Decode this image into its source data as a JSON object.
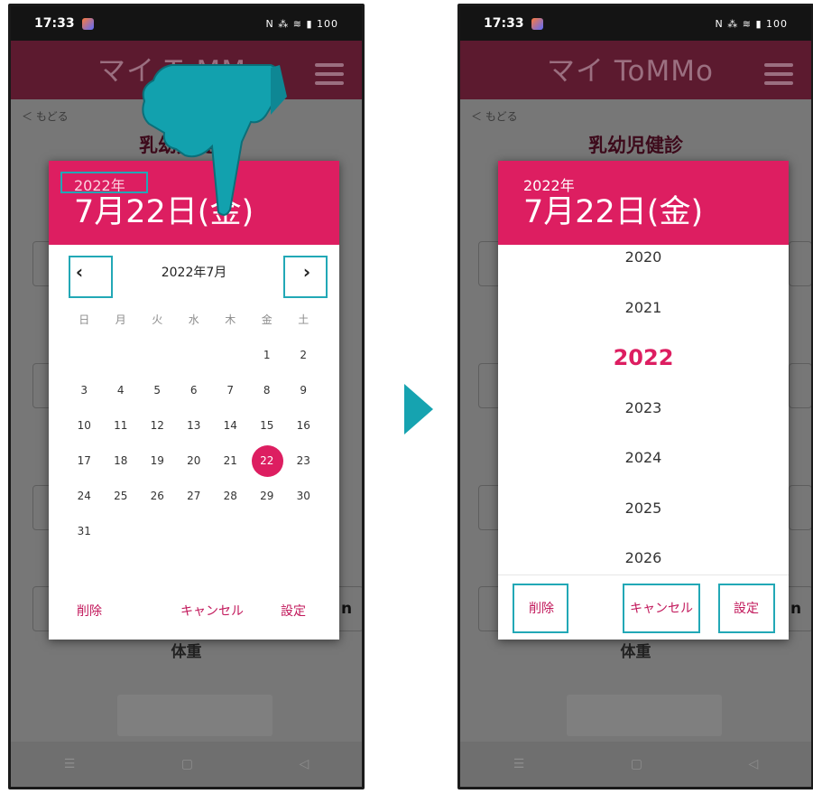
{
  "status": {
    "time": "17:33",
    "system": "N ⁂ ≋ ▮ 100"
  },
  "app": {
    "logo": "マイ ToMMo"
  },
  "header": {
    "back": "＜ もどる",
    "title": "乳幼児健診"
  },
  "form": {
    "weight_label": "体重",
    "unit_visible": "n"
  },
  "datepicker": {
    "year": "2022年",
    "date": "7月22日(金)",
    "month_label": "2022年7月",
    "weekdays": [
      "日",
      "月",
      "火",
      "水",
      "木",
      "金",
      "土"
    ],
    "weeks": [
      [
        "",
        "",
        "",
        "",
        "",
        "1",
        "2"
      ],
      [
        "3",
        "4",
        "5",
        "6",
        "7",
        "8",
        "9"
      ],
      [
        "10",
        "11",
        "12",
        "13",
        "14",
        "15",
        "16"
      ],
      [
        "17",
        "18",
        "19",
        "20",
        "21",
        "22",
        "23"
      ],
      [
        "24",
        "25",
        "26",
        "27",
        "28",
        "29",
        "30"
      ],
      [
        "31",
        "",
        "",
        "",
        "",
        "",
        ""
      ]
    ],
    "selected_day": "22",
    "prev": "‹",
    "next": "›",
    "actions": {
      "delete": "削除",
      "cancel": "キャンセル",
      "ok": "設定"
    }
  },
  "yearpicker": {
    "years": [
      "2020",
      "2021",
      "2022",
      "2023",
      "2024",
      "2025",
      "2026"
    ],
    "selected": "2022"
  },
  "nav": {
    "recents": "☰",
    "home": "▢",
    "back": "◁"
  },
  "colors": {
    "accent": "#dd1e61",
    "highlight": "#22a8b6",
    "header": "#5c1a2f"
  }
}
